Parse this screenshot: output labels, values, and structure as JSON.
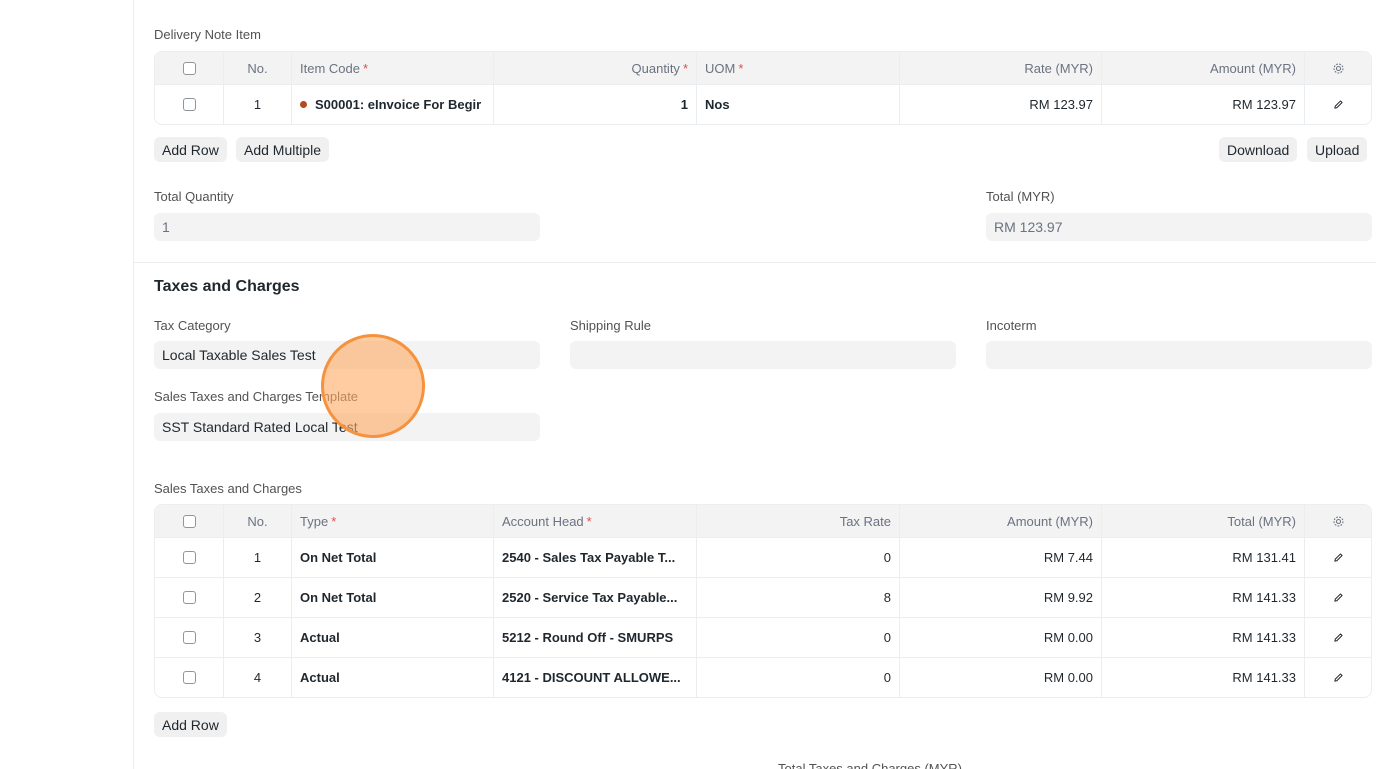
{
  "delivery_note_items": {
    "label": "Delivery Note Item",
    "columns": {
      "no": "No.",
      "item_code": "Item Code",
      "quantity": "Quantity",
      "uom": "UOM",
      "rate": "Rate (MYR)",
      "amount": "Amount (MYR)"
    },
    "rows": [
      {
        "no": "1",
        "item_code": "S00001: eInvoice For Begir",
        "quantity": "1",
        "uom": "Nos",
        "rate": "RM 123.97",
        "amount": "RM 123.97"
      }
    ],
    "add_row": "Add Row",
    "add_multiple": "Add Multiple",
    "download": "Download",
    "upload": "Upload"
  },
  "totals": {
    "total_quantity_label": "Total Quantity",
    "total_quantity_value": "1",
    "total_label": "Total (MYR)",
    "total_value": "RM 123.97"
  },
  "taxes_section": {
    "title": "Taxes and Charges",
    "tax_category_label": "Tax Category",
    "tax_category_value": "Local Taxable Sales Test",
    "shipping_rule_label": "Shipping Rule",
    "shipping_rule_value": "",
    "incoterm_label": "Incoterm",
    "incoterm_value": "",
    "template_label": "Sales Taxes and Charges Template",
    "template_value": "SST Standard Rated Local Test"
  },
  "sales_taxes": {
    "label": "Sales Taxes and Charges",
    "columns": {
      "no": "No.",
      "type": "Type",
      "account_head": "Account Head",
      "tax_rate": "Tax Rate",
      "amount": "Amount (MYR)",
      "total": "Total (MYR)"
    },
    "rows": [
      {
        "no": "1",
        "type": "On Net Total",
        "account_head": "2540 - Sales Tax Payable T...",
        "tax_rate": "0",
        "amount": "RM 7.44",
        "total": "RM 131.41"
      },
      {
        "no": "2",
        "type": "On Net Total",
        "account_head": "2520 - Service Tax Payable...",
        "tax_rate": "8",
        "amount": "RM 9.92",
        "total": "RM 141.33"
      },
      {
        "no": "3",
        "type": "Actual",
        "account_head": "5212 - Round Off - SMURPS",
        "tax_rate": "0",
        "amount": "RM 0.00",
        "total": "RM 141.33"
      },
      {
        "no": "4",
        "type": "Actual",
        "account_head": "4121 - DISCOUNT ALLOWE...",
        "tax_rate": "0",
        "amount": "RM 0.00",
        "total": "RM 141.33"
      }
    ],
    "add_row": "Add Row"
  },
  "footer_partial_label": "Total Taxes and Charges (MYR)",
  "colors": {
    "required": "#e24c4c",
    "item_dot": "#b5491f",
    "cursor": "#f5923e"
  },
  "icons": {
    "settings": "gear-icon",
    "edit": "pencil-icon"
  }
}
